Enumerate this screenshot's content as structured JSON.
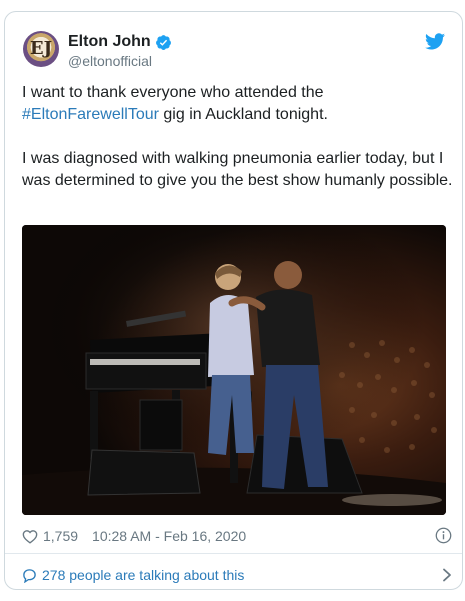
{
  "tweet": {
    "author": {
      "display_name": "Elton John",
      "handle": "@eltonofficial",
      "verified": true,
      "avatar_monogram": "EJ"
    },
    "text": {
      "line1_prefix": "I want to thank everyone who attended the",
      "hashtag": "#EltonFarewellTour",
      "line1_suffix": " gig in Auckland tonight.",
      "paragraph2": "I was diagnosed with walking pneumonia earlier today, but I was determined to give you the best show humanly possible."
    },
    "likes": "1,759",
    "timestamp": "10:28 AM - Feb 16, 2020",
    "talking_link": "278 people are talking about this"
  },
  "icons": {
    "verified": "verified-badge-icon",
    "brand": "twitter-bird-icon",
    "like": "heart-icon",
    "info": "info-icon",
    "conversation": "speech-bubble-icon",
    "chevron": "chevron-right-icon"
  },
  "colors": {
    "link": "#2b7bb9",
    "twitter_blue": "#1da1f2",
    "muted": "#697882",
    "border": "#cfd9de"
  }
}
